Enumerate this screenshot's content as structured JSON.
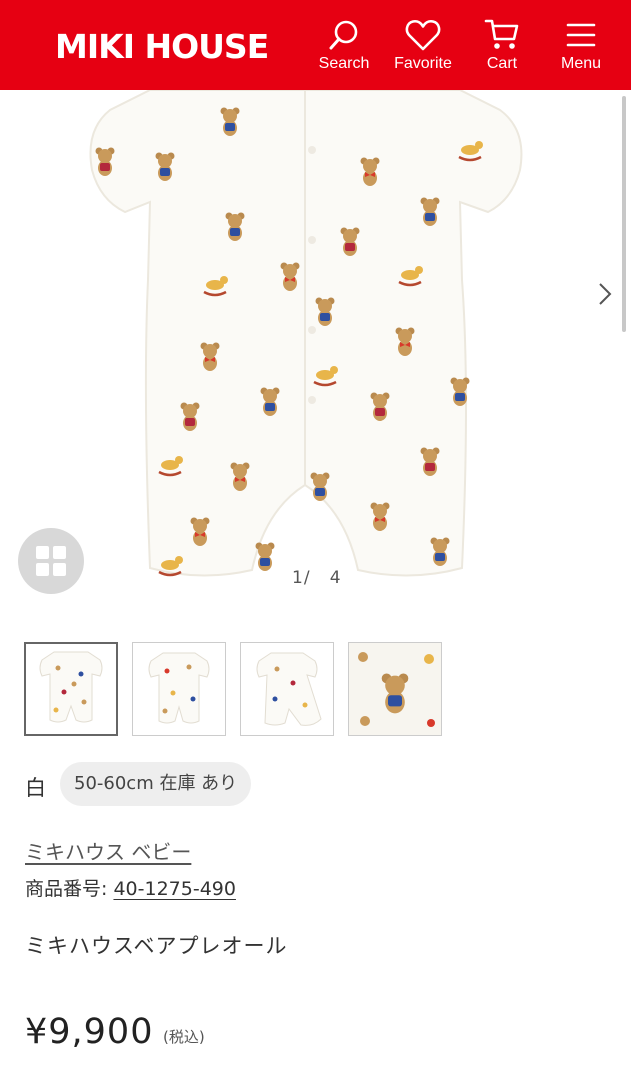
{
  "header": {
    "logo": "MIKI HOUSE",
    "nav": [
      {
        "label": "Search",
        "icon": "search-icon"
      },
      {
        "label": "Favorite",
        "icon": "heart-icon"
      },
      {
        "label": "Cart",
        "icon": "cart-icon"
      },
      {
        "label": "Menu",
        "icon": "hamburger-menu-icon"
      }
    ]
  },
  "gallery": {
    "current_page": "1",
    "separator": "/",
    "total_pages": "4"
  },
  "product": {
    "color": "白",
    "size_stock": "50-60cm 在庫 あり",
    "brand": "ミキハウス ベビー",
    "sku_label": "商品番号:",
    "sku": "40-1275-490",
    "name": "ミキハウスベアプレオール",
    "price": "¥9,900",
    "tax_note": "(税込)"
  },
  "colors": {
    "brand_red": "#e60012",
    "chip_bg": "#eeeeee"
  }
}
